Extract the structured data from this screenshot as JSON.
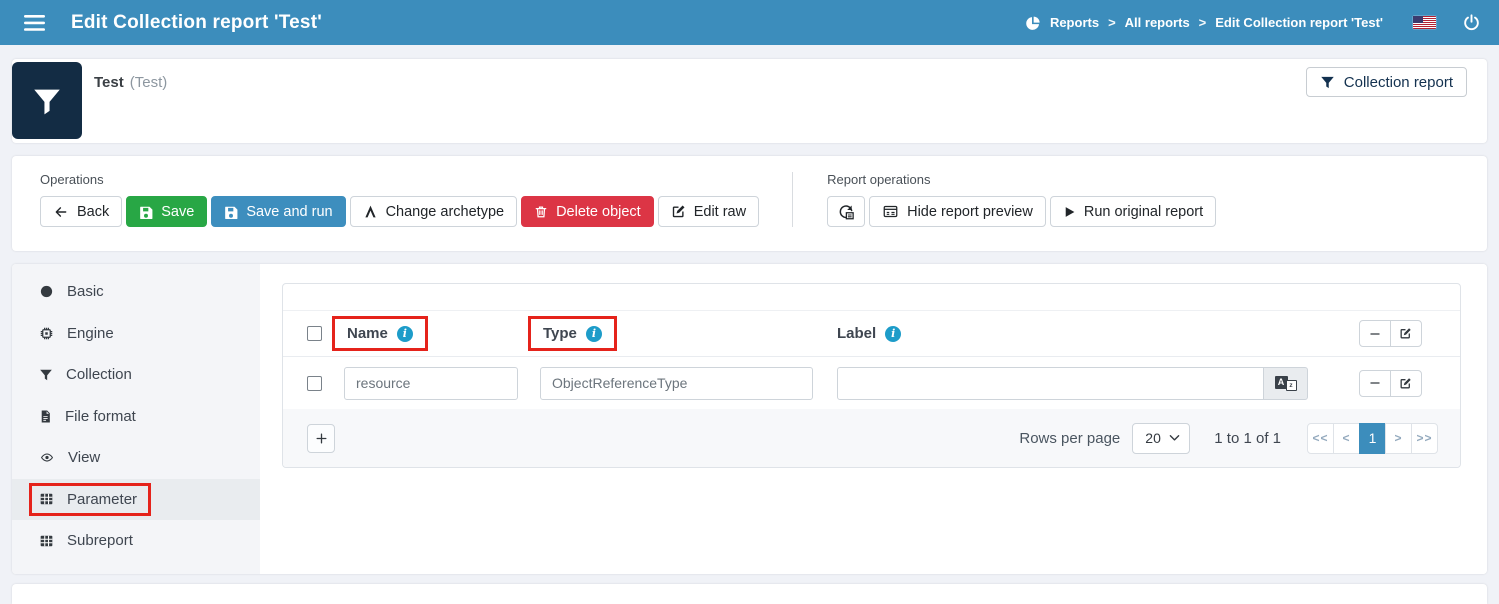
{
  "topbar": {
    "title": "Edit Collection report 'Test'",
    "breadcrumb": [
      "Reports",
      "All reports",
      "Edit Collection report 'Test'"
    ],
    "separator": ">"
  },
  "summary": {
    "name": "Test",
    "display_name": "(Test)",
    "type_badge": "Collection report"
  },
  "operations": {
    "label": "Operations",
    "back": "Back",
    "save": "Save",
    "save_and_run": "Save and run",
    "change_archetype": "Change archetype",
    "delete_object": "Delete object",
    "edit_raw": "Edit raw"
  },
  "report_operations": {
    "label": "Report operations",
    "hide_preview": "Hide report preview",
    "run_original": "Run original report"
  },
  "sidebar": {
    "items": [
      {
        "label": "Basic",
        "icon": "circle-icon"
      },
      {
        "label": "Engine",
        "icon": "microchip-icon"
      },
      {
        "label": "Collection",
        "icon": "filter-icon"
      },
      {
        "label": "File format",
        "icon": "file-icon"
      },
      {
        "label": "View",
        "icon": "eye-icon"
      },
      {
        "label": "Parameter",
        "icon": "table-icon",
        "active": true,
        "annotated": true
      },
      {
        "label": "Subreport",
        "icon": "table-icon"
      }
    ]
  },
  "parameters_table": {
    "columns": {
      "name": "Name",
      "type": "Type",
      "label": "Label"
    },
    "annotated_columns": [
      "Name",
      "Type"
    ],
    "rows": [
      {
        "name": "resource",
        "type": "ObjectReferenceType",
        "label": ""
      }
    ],
    "footer": {
      "rows_per_page_label": "Rows per page",
      "page_size": "20",
      "range_text": "1 to 1 of 1",
      "pager": {
        "first": "<<",
        "prev": "<",
        "page": "1",
        "next": ">",
        "last": ">>"
      }
    }
  },
  "colors": {
    "topbar": "#3c8dbc",
    "accent_dark": "#132c44",
    "success": "#28a745",
    "danger": "#dc3545",
    "info_icon": "#1d9cc9",
    "annotation_red": "#e5231b",
    "active_page": "#3c8dbc"
  }
}
